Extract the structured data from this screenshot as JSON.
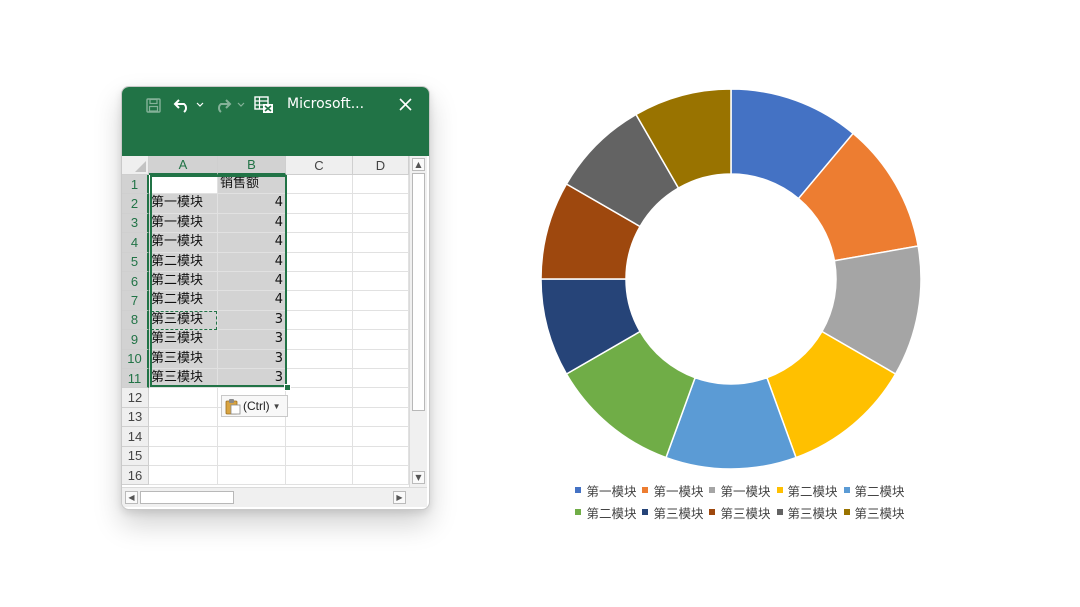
{
  "window": {
    "title": "Microsoft...",
    "accent": "#217346"
  },
  "sheet": {
    "columns": [
      "A",
      "B",
      "C",
      "D"
    ],
    "selected_columns": [
      "A",
      "B"
    ],
    "rows": [
      {
        "num": "1",
        "a": "",
        "b": "销售额"
      },
      {
        "num": "2",
        "a": "第一模块",
        "b": "4"
      },
      {
        "num": "3",
        "a": "第一模块",
        "b": "4"
      },
      {
        "num": "4",
        "a": "第一模块",
        "b": "4"
      },
      {
        "num": "5",
        "a": "第二模块",
        "b": "4"
      },
      {
        "num": "6",
        "a": "第二模块",
        "b": "4"
      },
      {
        "num": "7",
        "a": "第二模块",
        "b": "4"
      },
      {
        "num": "8",
        "a": "第三模块",
        "b": "3"
      },
      {
        "num": "9",
        "a": "第三模块",
        "b": "3"
      },
      {
        "num": "10",
        "a": "第三模块",
        "b": "3"
      },
      {
        "num": "11",
        "a": "第三模块",
        "b": "3"
      },
      {
        "num": "12",
        "a": "",
        "b": ""
      },
      {
        "num": "13",
        "a": "",
        "b": ""
      },
      {
        "num": "14",
        "a": "",
        "b": ""
      },
      {
        "num": "15",
        "a": "",
        "b": ""
      },
      {
        "num": "16",
        "a": "",
        "b": ""
      }
    ],
    "paste_options_label": "(Ctrl)"
  },
  "chart_data": {
    "type": "pie",
    "donut": true,
    "categories": [
      "第一模块",
      "第一模块",
      "第一模块",
      "第二模块",
      "第二模块",
      "第二模块",
      "第三模块",
      "第三模块",
      "第三模块",
      "第三模块"
    ],
    "values": [
      4,
      4,
      4,
      4,
      4,
      4,
      3,
      3,
      3,
      3
    ],
    "colors": [
      "#4472C4",
      "#ED7D31",
      "#A5A5A5",
      "#FFC000",
      "#5B9BD5",
      "#70AD47",
      "#264478",
      "#9E480E",
      "#636363",
      "#997300"
    ],
    "legend": "bottom"
  }
}
